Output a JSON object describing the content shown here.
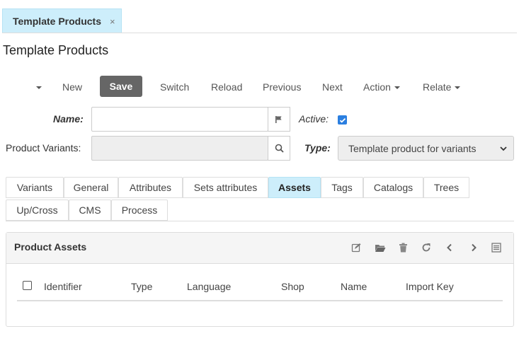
{
  "document_tab": {
    "label": "Template Products",
    "close": "×"
  },
  "page": {
    "title": "Template Products"
  },
  "toolbar": {
    "new": "New",
    "save": "Save",
    "switch": "Switch",
    "reload": "Reload",
    "previous": "Previous",
    "next": "Next",
    "action": "Action",
    "relate": "Relate"
  },
  "form": {
    "name_label": "Name:",
    "name_value": "",
    "active_label": "Active:",
    "active_checked": true,
    "variants_label": "Product Variants:",
    "variants_value": "",
    "type_label": "Type:",
    "type_value": "Template product for variants"
  },
  "tabs": [
    {
      "label": "Variants"
    },
    {
      "label": "General"
    },
    {
      "label": "Attributes"
    },
    {
      "label": "Sets attributes"
    },
    {
      "label": "Assets",
      "active": true
    },
    {
      "label": "Tags"
    },
    {
      "label": "Catalogs"
    },
    {
      "label": "Trees"
    },
    {
      "label": "Up/Cross"
    },
    {
      "label": "CMS"
    },
    {
      "label": "Process"
    }
  ],
  "panel": {
    "title": "Product Assets",
    "tools": [
      "edit-icon",
      "folder-open-icon",
      "trash-icon",
      "refresh-icon",
      "chevron-left-icon",
      "chevron-right-icon",
      "list-icon"
    ],
    "columns": [
      "Identifier",
      "Type",
      "Language",
      "Shop",
      "Name",
      "Import Key"
    ]
  },
  "colors": {
    "accent": "#cdeefb",
    "save_button": "#666666",
    "checkbox": "#2b7fe0"
  }
}
